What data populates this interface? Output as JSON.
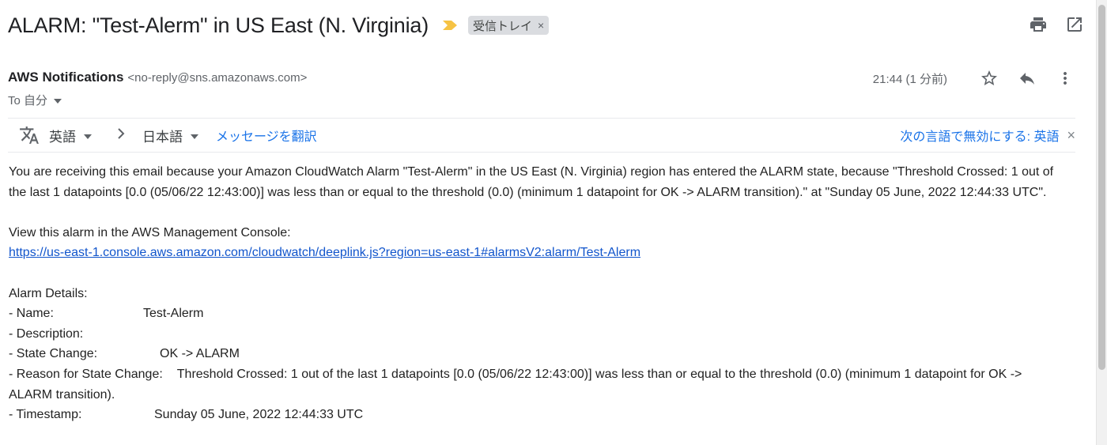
{
  "email": {
    "subject": "ALARM: \"Test-Alerm\" in US East (N. Virginia)",
    "label_chip": "受信トレイ",
    "label_remove": "×",
    "sender_name": "AWS Notifications",
    "sender_email": "<no-reply@sns.amazonaws.com>",
    "to_text": "To 自分",
    "time": "21:44 (1 分前)"
  },
  "translate": {
    "from_lang": "英語",
    "to_lang": "日本語",
    "translate_link": "メッセージを翻訳",
    "disable_text": "次の言語で無効にする: 英語",
    "close": "×"
  },
  "body": {
    "intro": "You are receiving this email because your Amazon CloudWatch Alarm \"Test-Alerm\" in the US East (N. Virginia) region has entered the ALARM state, because \"Threshold Crossed: 1 out of the last 1 datapoints [0.0 (05/06/22 12:43:00)] was less than or equal to the threshold (0.0) (minimum 1 datapoint for OK -> ALARM transition).\" at \"Sunday 05 June, 2022 12:44:33 UTC\".",
    "console_label": "View this alarm in the AWS Management Console:",
    "console_link": "https://us-east-1.console.aws.amazon.com/cloudwatch/deeplink.js?region=us-east-1#alarmsV2:alarm/Test-Alerm",
    "details_heading": "Alarm Details:",
    "name_label": "- Name:",
    "name_value": "Test-Alerm",
    "description_label": "- Description:",
    "state_label": "- State Change:",
    "state_value": "OK -> ALARM",
    "reason_label": "- Reason for State Change:",
    "reason_value": "Threshold Crossed: 1 out of the last 1 datapoints [0.0 (05/06/22 12:43:00)] was less than or equal to the threshold (0.0) (minimum 1 datapoint for OK -> ALARM transition).",
    "timestamp_label": "- Timestamp:",
    "timestamp_value": "Sunday 05 June, 2022 12:44:33 UTC"
  },
  "icons": {
    "importance": "importance-marker-icon",
    "print": "print-icon",
    "open_new_window": "open-in-new-window-icon",
    "star": "star-icon",
    "reply": "reply-icon",
    "more": "more-vertical-icon",
    "translate": "translate-icon",
    "dropdown": "chevron-down-icon",
    "arrow": "chevron-right-icon"
  },
  "colors": {
    "link": "#1155cc",
    "accent_blue": "#1a73e8",
    "importance": "#f6c344",
    "chip_bg": "#dadce0"
  }
}
